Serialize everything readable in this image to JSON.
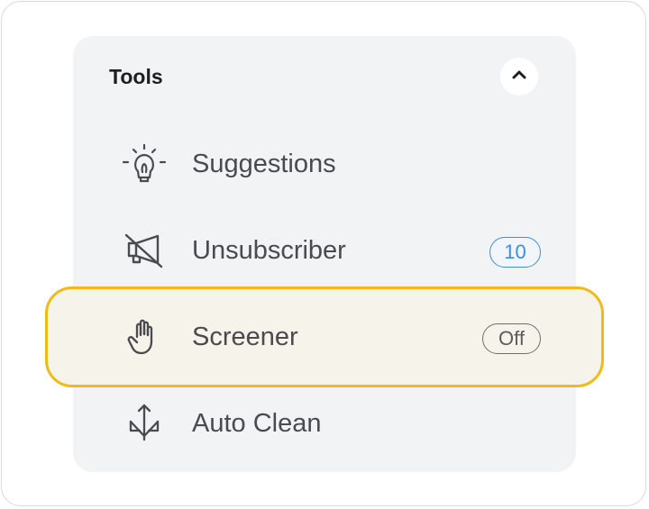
{
  "tools": {
    "title": "Tools",
    "items": [
      {
        "label": "Suggestions",
        "icon": "lightbulb-icon"
      },
      {
        "label": "Unsubscriber",
        "icon": "muted-megaphone-icon",
        "badge": "10"
      },
      {
        "label": "Screener",
        "icon": "raised-hand-icon",
        "badge": "Off",
        "highlighted": true
      },
      {
        "label": "Auto Clean",
        "icon": "auto-clean-arrows-icon"
      }
    ]
  },
  "colors": {
    "highlight_border": "#f0bb18",
    "count_badge": "#3b8fdc",
    "panel_background": "#f2f3f5"
  }
}
